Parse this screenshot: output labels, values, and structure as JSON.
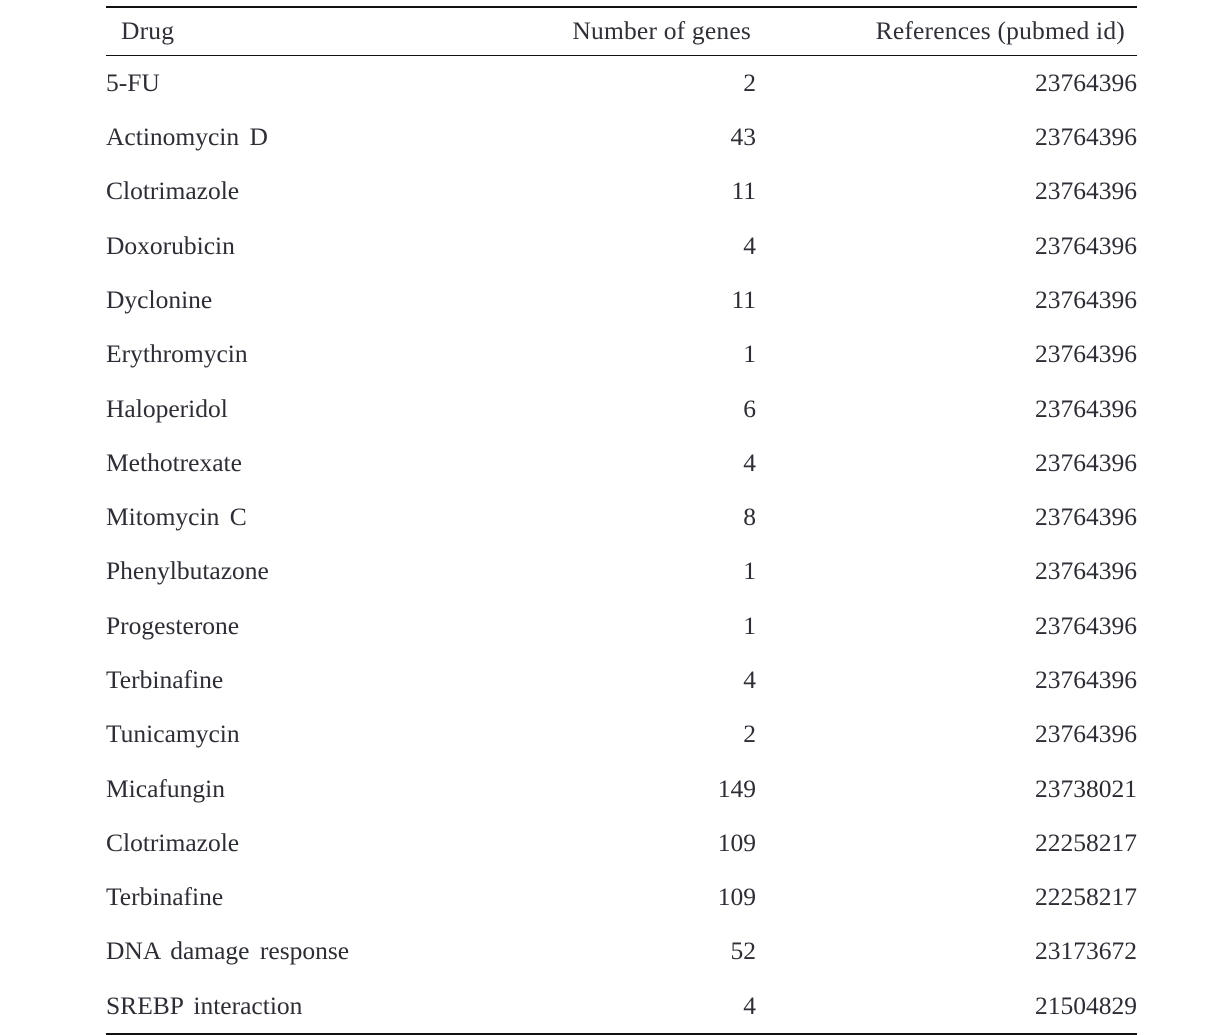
{
  "table": {
    "columns": [
      {
        "key": "drug",
        "label": "Drug",
        "align": "left"
      },
      {
        "key": "genes",
        "label": "Number of genes",
        "align": "right"
      },
      {
        "key": "reference",
        "label": "References (pubmed id)",
        "align": "right"
      }
    ],
    "rows": [
      {
        "drug": "5-FU",
        "genes": "2",
        "reference": "23764396"
      },
      {
        "drug": "Actinomycin  D",
        "genes": "43",
        "reference": "23764396"
      },
      {
        "drug": "Clotrimazole",
        "genes": "11",
        "reference": "23764396"
      },
      {
        "drug": "Doxorubicin",
        "genes": "4",
        "reference": "23764396"
      },
      {
        "drug": "Dyclonine",
        "genes": "11",
        "reference": "23764396"
      },
      {
        "drug": "Erythromycin",
        "genes": "1",
        "reference": "23764396"
      },
      {
        "drug": "Haloperidol",
        "genes": "6",
        "reference": "23764396"
      },
      {
        "drug": "Methotrexate",
        "genes": "4",
        "reference": "23764396"
      },
      {
        "drug": "Mitomycin  C",
        "genes": "8",
        "reference": "23764396"
      },
      {
        "drug": "Phenylbutazone",
        "genes": "1",
        "reference": "23764396"
      },
      {
        "drug": "Progesterone",
        "genes": "1",
        "reference": "23764396"
      },
      {
        "drug": "Terbinafine",
        "genes": "4",
        "reference": "23764396"
      },
      {
        "drug": "Tunicamycin",
        "genes": "2",
        "reference": "23764396"
      },
      {
        "drug": "Micafungin",
        "genes": "149",
        "reference": "23738021"
      },
      {
        "drug": "Clotrimazole",
        "genes": "109",
        "reference": "22258217"
      },
      {
        "drug": "Terbinafine",
        "genes": "109",
        "reference": "22258217"
      },
      {
        "drug": "DNA  damage  response",
        "genes": "52",
        "reference": "23173672"
      },
      {
        "drug": "SREBP  interaction",
        "genes": "4",
        "reference": "21504829"
      }
    ],
    "rule_color": "#111111",
    "text_color": "#2d2d35"
  }
}
